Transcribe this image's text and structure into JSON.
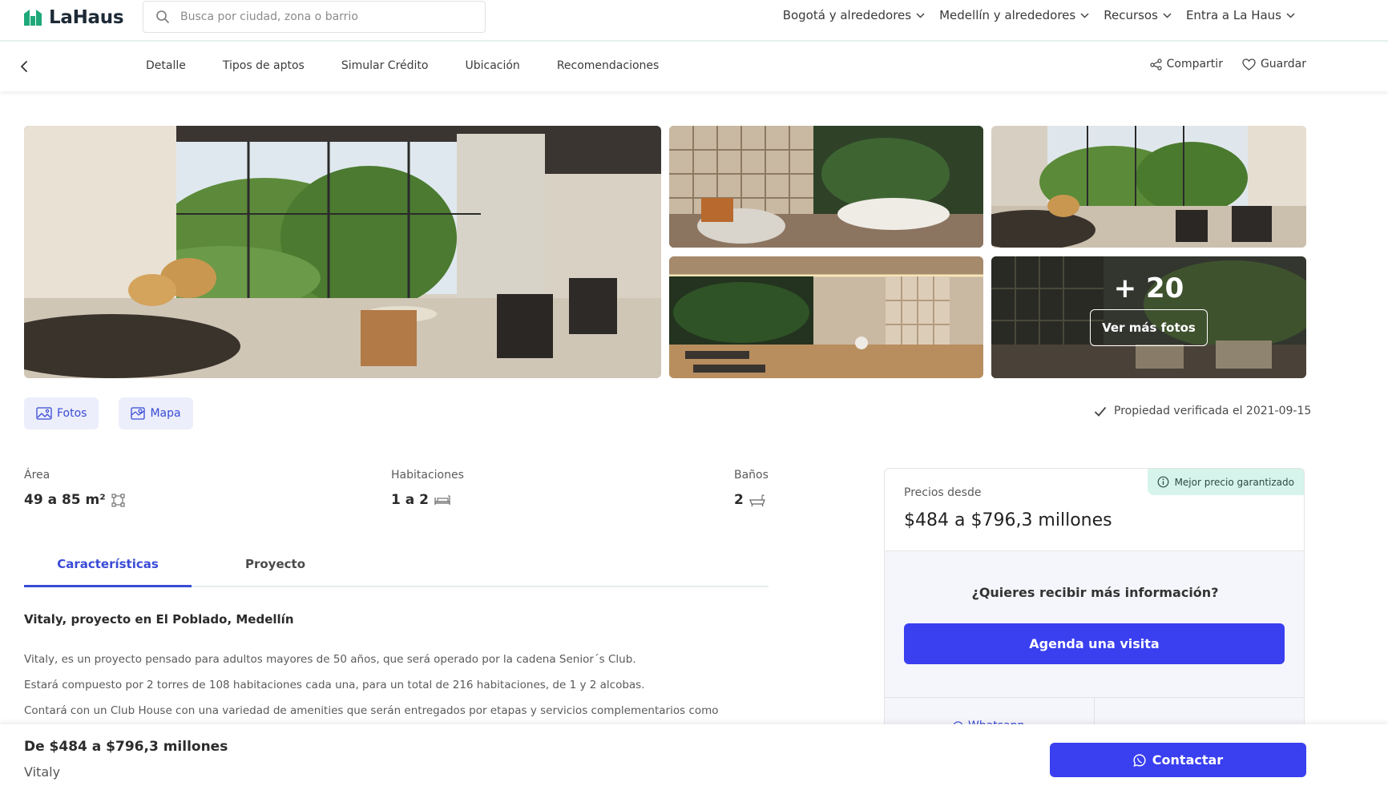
{
  "brand": {
    "name": "LaHaus",
    "color": "#1fa97a",
    "accent": "#3a3ff0"
  },
  "search": {
    "placeholder": "Busca por ciudad, zona o barrio"
  },
  "topnav": [
    {
      "label": "Bogotá y alrededores",
      "icon": "chevron-down-icon"
    },
    {
      "label": "Medellín y alrededores",
      "icon": "chevron-down-icon"
    },
    {
      "label": "Recursos",
      "icon": "chevron-down-icon"
    },
    {
      "label": "Entra a La Haus",
      "icon": "chevron-down-icon"
    }
  ],
  "subnav": {
    "links": [
      "Detalle",
      "Tipos de aptos",
      "Simular Crédito",
      "Ubicación",
      "Recomendaciones"
    ],
    "share_label": "Compartir",
    "save_label": "Guardar"
  },
  "gallery": {
    "more_count": "+ 20",
    "more_label": "Ver más fotos"
  },
  "media": {
    "photos_label": "Fotos",
    "map_label": "Mapa"
  },
  "verified": {
    "text": "Propiedad verificada el 2021-09-15"
  },
  "stats": {
    "area": {
      "label": "Área",
      "value": "49 a 85 m²"
    },
    "rooms": {
      "label": "Habitaciones",
      "value": "1 a 2"
    },
    "baths": {
      "label": "Baños",
      "value": "2"
    }
  },
  "tabs": {
    "features": "Características",
    "project": "Proyecto"
  },
  "description": {
    "title": "Vitaly, proyecto en El Poblado, Medellín",
    "paragraphs": [
      "Vitaly, es un proyecto pensado para adultos mayores de 50 años, que será operado por la cadena Senior´s Club.",
      "Estará compuesto por 2 torres de 108 habitaciones cada una, para un total de 216 habitaciones, de 1 y 2 alcobas.",
      "Contará con un Club House con una variedad de amenities que serán entregados por etapas y servicios complementarios como"
    ]
  },
  "price_card": {
    "badge": "Mejor precio garantizado",
    "label": "Precios desde",
    "price": "$484 a $796,3 millones",
    "question": "¿Quieres recibir más información?",
    "cta": "Agenda una visita",
    "whatsapp": "Whatsapp"
  },
  "bottom_bar": {
    "price": "De $484 a $796,3 millones",
    "name": "Vitaly",
    "contact": "Contactar"
  }
}
